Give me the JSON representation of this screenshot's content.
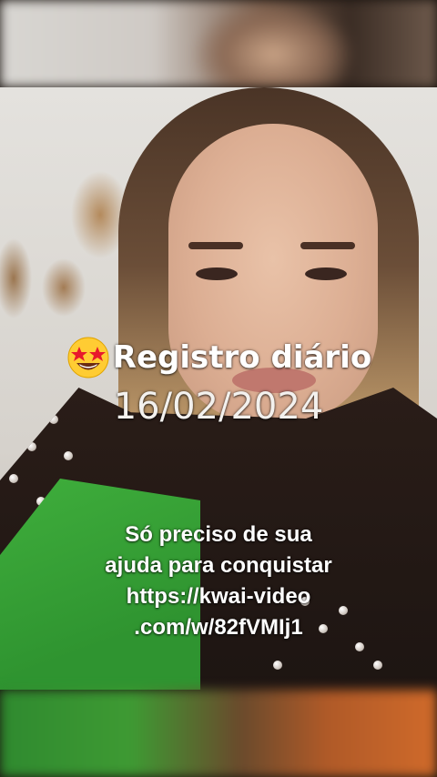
{
  "overlay": {
    "title": "Registro diário",
    "title_emoji": "star-struck-emoji",
    "date": "16/02/2024",
    "message_lines": [
      "Só preciso de sua",
      "ajuda para conquistar",
      "https://kwai-video",
      ".com/w/82fVMIj1"
    ]
  },
  "colors": {
    "text": "#ffffff",
    "shirt_green": "#3fae3c",
    "jacket_dark": "#2a1d18"
  }
}
